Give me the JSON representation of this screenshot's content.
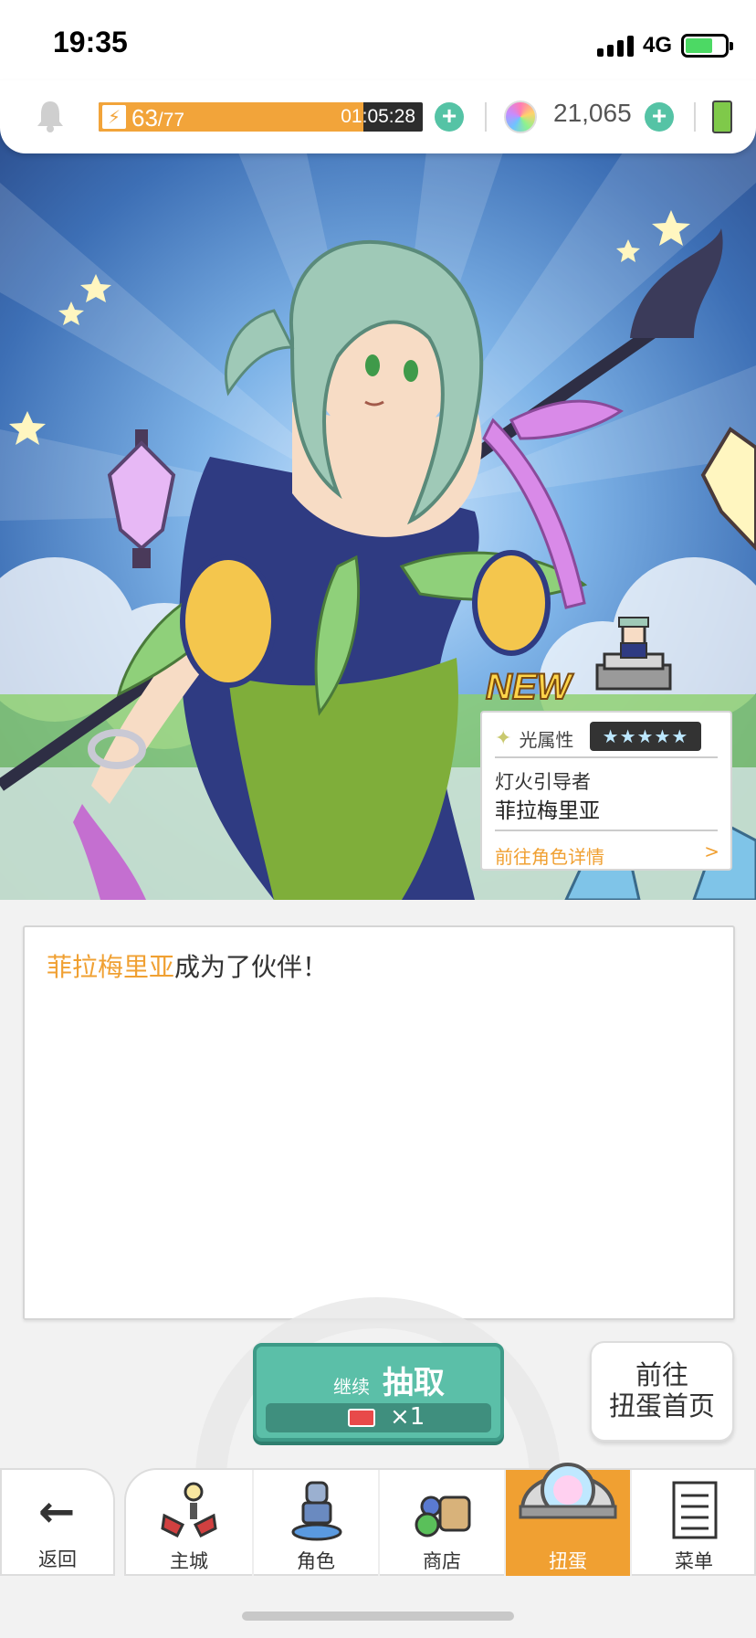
{
  "status_bar": {
    "time": "19:35",
    "network": "4G"
  },
  "resources": {
    "stamina_current": "63",
    "stamina_max": "/77",
    "stamina_fraction": 0.818,
    "stamina_timer": "01:05:28",
    "gems": "21,065"
  },
  "hero": {
    "new_badge": "NEW"
  },
  "character_card": {
    "element": "光属性",
    "rarity_stars": 5,
    "title": "灯火引导者",
    "name": "菲拉梅里亚",
    "detail_link": "前往角色详情",
    "detail_arrow": ">"
  },
  "message": {
    "name": "菲拉梅里亚",
    "text": "成为了伙伴！"
  },
  "draw": {
    "continue_small": "继续",
    "continue_big": "抽取",
    "cost": "×1",
    "gacha_home_line1": "前往",
    "gacha_home_line2": "扭蛋首页"
  },
  "nav": {
    "back": "返回",
    "items": [
      {
        "label": "主城",
        "icon": "town-icon"
      },
      {
        "label": "角色",
        "icon": "character-icon"
      },
      {
        "label": "商店",
        "icon": "shop-icon"
      },
      {
        "label": "扭蛋",
        "icon": "gacha-icon",
        "active": true
      },
      {
        "label": "菜单",
        "icon": "menu-icon"
      }
    ]
  },
  "colors": {
    "accent": "#f0a032",
    "teal": "#5bbfa8",
    "star": "#ffd54a"
  }
}
